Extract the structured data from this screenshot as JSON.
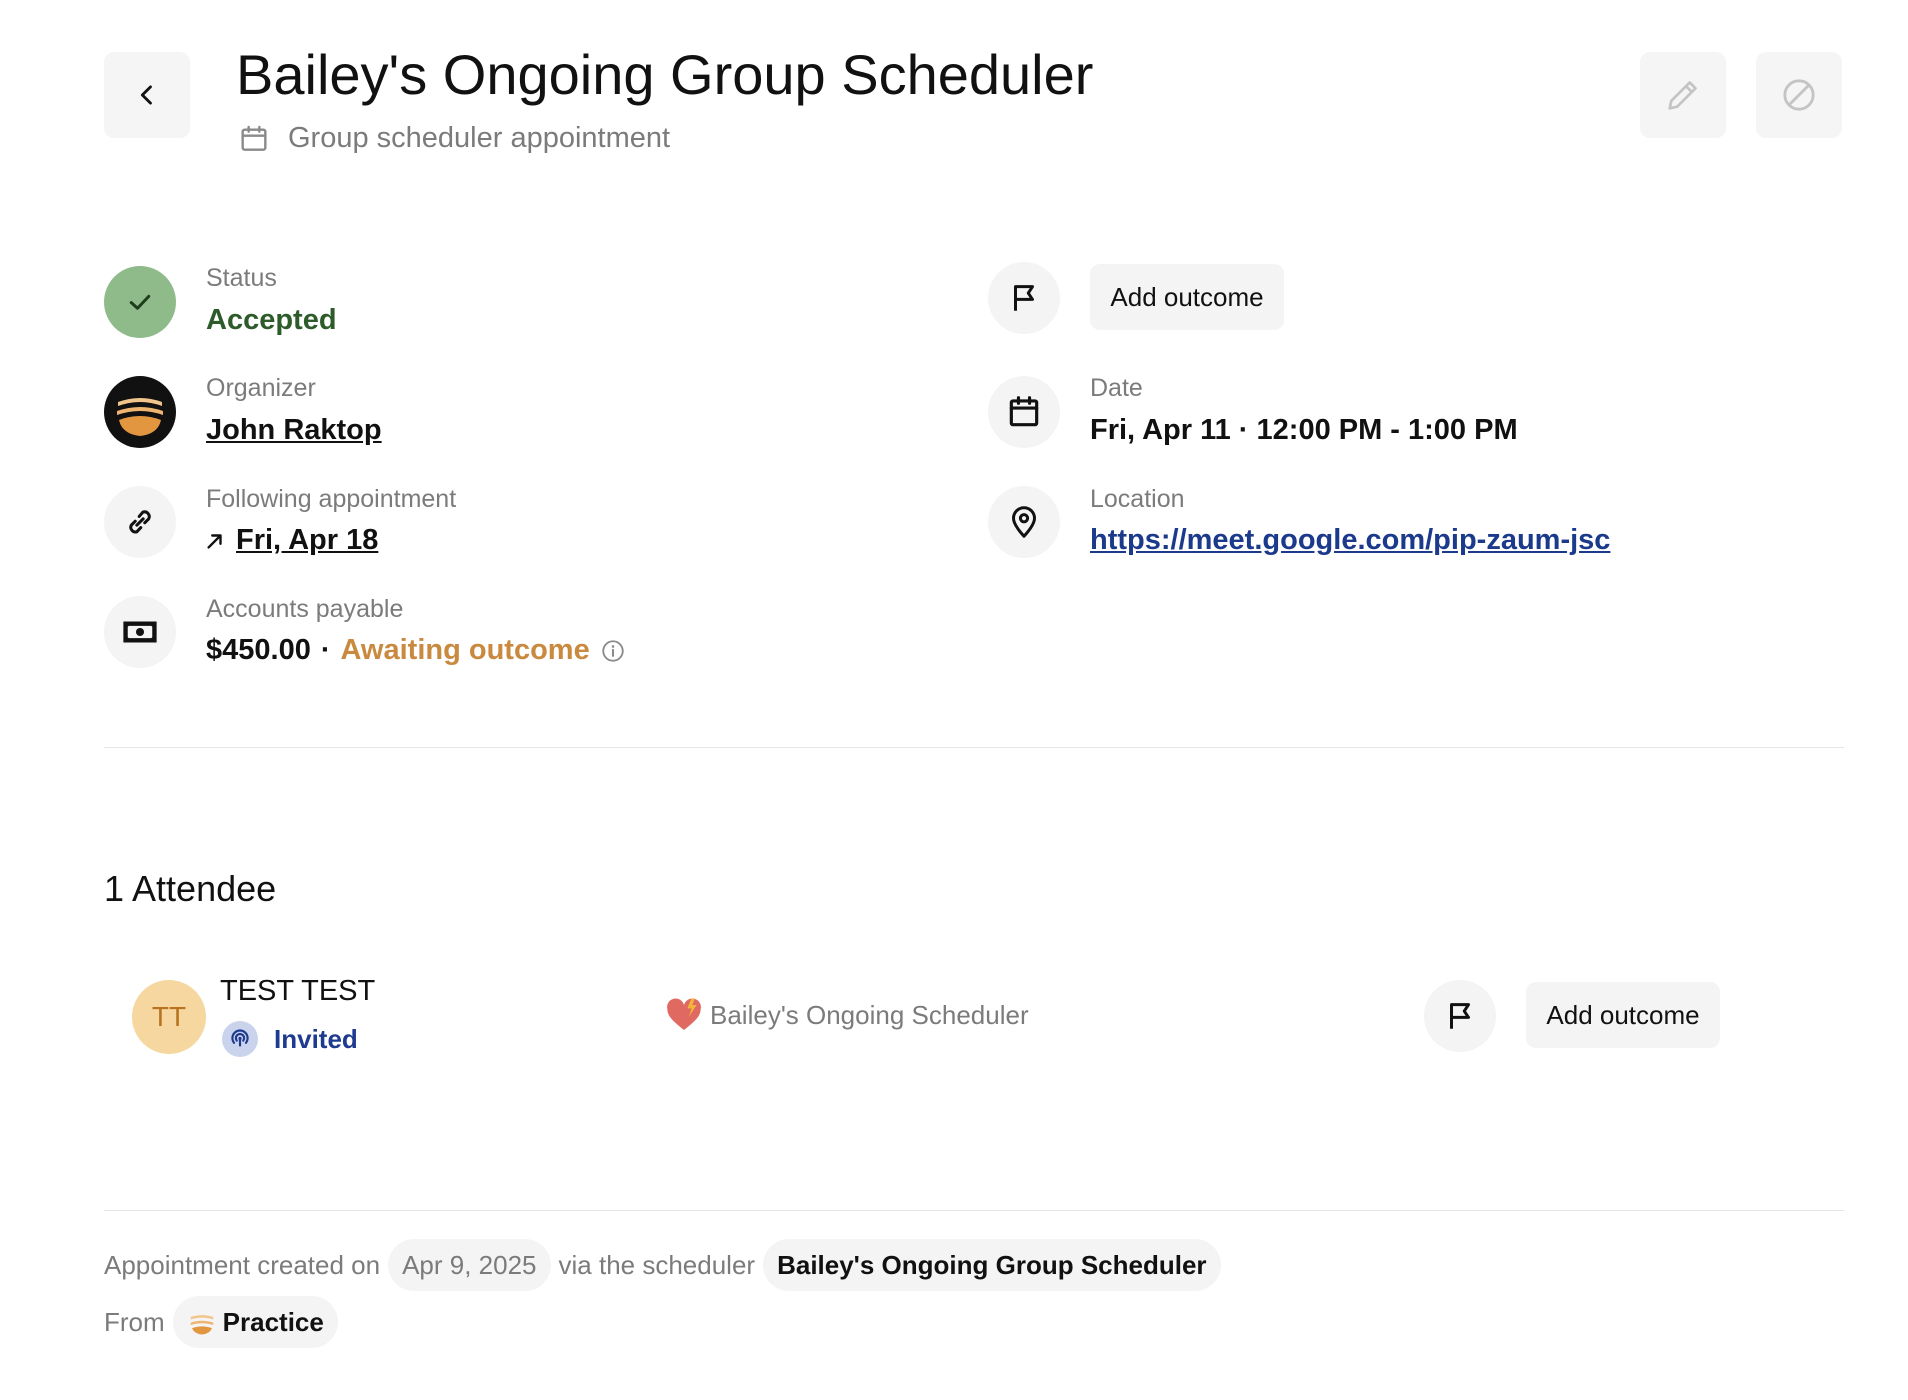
{
  "header": {
    "title": "Bailey's Ongoing Group Scheduler",
    "subtitle": "Group scheduler appointment"
  },
  "details": {
    "status": {
      "label": "Status",
      "value": "Accepted"
    },
    "organizer": {
      "label": "Organizer",
      "value": "John Raktop"
    },
    "following": {
      "label": "Following appointment",
      "value": "Fri, Apr 18"
    },
    "payable": {
      "label": "Accounts payable",
      "amount": "$450.00",
      "separator": "·",
      "state": "Awaiting outcome"
    },
    "outcome_button": "Add outcome",
    "date": {
      "label": "Date",
      "value": "Fri, Apr 11 · 12:00 PM - 1:00 PM"
    },
    "location": {
      "label": "Location",
      "value": "https://meet.google.com/pip-zaum-jsc"
    }
  },
  "attendees": {
    "heading": "1 Attendee",
    "items": [
      {
        "initials": "TT",
        "name": "TEST TEST",
        "status": "Invited",
        "scheduler": "Bailey's Ongoing Scheduler",
        "outcome_button": "Add outcome"
      }
    ]
  },
  "footer": {
    "created_prefix": "Appointment created on",
    "created_date": "Apr 9, 2025",
    "via_text": "via the scheduler",
    "scheduler_name": "Bailey's Ongoing Group Scheduler",
    "from_label": "From",
    "from_value": "Practice"
  },
  "colors": {
    "accepted_green": "#2e5b2a",
    "status_circle": "#8fbb8b",
    "awaiting_orange": "#c98a3f",
    "link_blue": "#1b3a8c",
    "invited_blue": "#1f3b8f",
    "avatar_bg": "#f5d79f",
    "avatar_text": "#b9731f"
  }
}
